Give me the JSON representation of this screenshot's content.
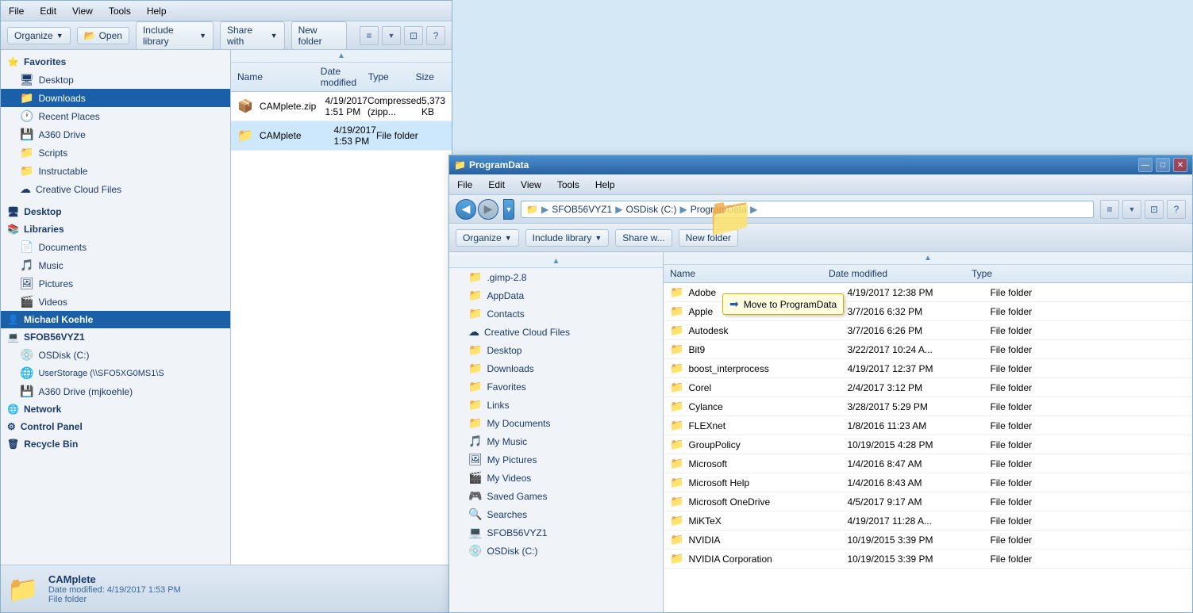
{
  "mainWindow": {
    "menuBar": {
      "items": [
        "File",
        "Edit",
        "View",
        "Tools",
        "Help"
      ]
    },
    "toolbar": {
      "organize": "Organize",
      "open": "Open",
      "includeLibrary": "Include library",
      "shareWith": "Share with",
      "newFolder": "New folder"
    },
    "sidebar": {
      "sections": [
        {
          "header": "Favorites",
          "icon": "⭐",
          "items": [
            {
              "label": "Desktop",
              "icon": "🖥"
            },
            {
              "label": "Downloads",
              "icon": "📁",
              "selected": true
            },
            {
              "label": "Recent Places",
              "icon": "🕐"
            },
            {
              "label": "A360 Drive",
              "icon": "💾"
            },
            {
              "label": "Scripts",
              "icon": "📁"
            },
            {
              "label": "Instructable",
              "icon": "📁"
            },
            {
              "label": "Creative Cloud Files",
              "icon": "☁"
            }
          ]
        },
        {
          "header": "Desktop",
          "icon": "🖥",
          "items": []
        },
        {
          "header": "Libraries",
          "icon": "📚",
          "items": [
            {
              "label": "Documents",
              "icon": "📄"
            },
            {
              "label": "Music",
              "icon": "🎵"
            },
            {
              "label": "Pictures",
              "icon": "🖼"
            },
            {
              "label": "Videos",
              "icon": "🎬"
            }
          ]
        },
        {
          "header": "Michael Koehle",
          "icon": "👤",
          "items": []
        },
        {
          "header": "SFOB56VYZ1",
          "icon": "💻",
          "items": [
            {
              "label": "OSDisk (C:)",
              "icon": "💿"
            },
            {
              "label": "UserStorage (\\\\SFO5XG0MS1\\S",
              "icon": "🌐"
            },
            {
              "label": "A360 Drive (mjkoehle)",
              "icon": "💾"
            }
          ]
        },
        {
          "header": "Network",
          "icon": "🌐",
          "items": []
        },
        {
          "header": "Control Panel",
          "icon": "⚙",
          "items": []
        },
        {
          "header": "Recycle Bin",
          "icon": "🗑",
          "items": []
        }
      ]
    },
    "fileList": {
      "headers": [
        "Name",
        "Date modified",
        "Type",
        "Size"
      ],
      "rows": [
        {
          "name": "CAMplete.zip",
          "icon": "📦",
          "date": "4/19/2017 1:51 PM",
          "type": "Compressed (zipp...",
          "size": "5,373 KB"
        },
        {
          "name": "CAMplete",
          "icon": "📁",
          "date": "4/19/2017 1:53 PM",
          "type": "File folder",
          "size": ""
        }
      ]
    },
    "statusBar": {
      "icon": "📁",
      "name": "CAMplete",
      "dateLabel": "Date modified:",
      "date": "4/19/2017 1:53 PM",
      "type": "File folder"
    }
  },
  "secondWindow": {
    "breadcrumb": {
      "parts": [
        "SFOB56VYZ1",
        "OSDisk (C:)",
        "ProgramData"
      ]
    },
    "toolbar": {
      "organize": "Organize",
      "includeLibrary": "Include library",
      "shareWith": "Share w...",
      "newFolder": "New folder"
    },
    "sidebar": {
      "items": [
        {
          "label": ".gimp-2.8",
          "icon": "📁"
        },
        {
          "label": "AppData",
          "icon": "📁"
        },
        {
          "label": "Contacts",
          "icon": "📁"
        },
        {
          "label": "Creative Cloud Files",
          "icon": "☁"
        },
        {
          "label": "Desktop",
          "icon": "📁"
        },
        {
          "label": "Downloads",
          "icon": "📁"
        },
        {
          "label": "Favorites",
          "icon": "📁"
        },
        {
          "label": "Links",
          "icon": "📁"
        },
        {
          "label": "My Documents",
          "icon": "📁"
        },
        {
          "label": "My Music",
          "icon": "🎵"
        },
        {
          "label": "My Pictures",
          "icon": "🖼"
        },
        {
          "label": "My Videos",
          "icon": "🎬"
        },
        {
          "label": "Saved Games",
          "icon": "🎮"
        },
        {
          "label": "Searches",
          "icon": "🔍"
        },
        {
          "label": "SFOB56VYZ1",
          "icon": "💻"
        },
        {
          "label": "OSDisk (C:)",
          "icon": "💿"
        }
      ]
    },
    "fileList": {
      "headers": [
        "Name",
        "Date modified",
        "Type"
      ],
      "rows": [
        {
          "name": "Adobe",
          "icon": "📁",
          "date": "4/19/2017 12:38 PM",
          "type": "File folder"
        },
        {
          "name": "Apple",
          "icon": "📁",
          "date": "3/7/2016 6:32 PM",
          "type": "File folder"
        },
        {
          "name": "Autodesk",
          "icon": "📁",
          "date": "3/7/2016 6:26 PM",
          "type": "File folder"
        },
        {
          "name": "Bit9",
          "icon": "📁",
          "date": "3/22/2017 10:24 A...",
          "type": "File folder"
        },
        {
          "name": "boost_interprocess",
          "icon": "📁",
          "date": "4/19/2017 12:37 PM",
          "type": "File folder"
        },
        {
          "name": "Corel",
          "icon": "📁",
          "date": "2/4/2017 3:12 PM",
          "type": "File folder"
        },
        {
          "name": "Cylance",
          "icon": "📁",
          "date": "3/28/2017 5:29 PM",
          "type": "File folder"
        },
        {
          "name": "FLEXnet",
          "icon": "📁",
          "date": "1/8/2016 11:23 AM",
          "type": "File folder"
        },
        {
          "name": "GroupPolicy",
          "icon": "📁",
          "date": "10/19/2015 4:28 PM",
          "type": "File folder"
        },
        {
          "name": "Microsoft",
          "icon": "📁",
          "date": "1/4/2016 8:47 AM",
          "type": "File folder"
        },
        {
          "name": "Microsoft Help",
          "icon": "📁",
          "date": "1/4/2016 8:43 AM",
          "type": "File folder"
        },
        {
          "name": "Microsoft OneDrive",
          "icon": "📁",
          "date": "4/5/2017 9:17 AM",
          "type": "File folder"
        },
        {
          "name": "MiKTeX",
          "icon": "📁",
          "date": "4/19/2017 11:28 A...",
          "type": "File folder"
        },
        {
          "name": "NVIDIA",
          "icon": "📁",
          "date": "10/19/2015 3:39 PM",
          "type": "File folder"
        },
        {
          "name": "NVIDIA Corporation",
          "icon": "📁",
          "date": "10/19/2015 3:39 PM",
          "type": "File folder"
        }
      ]
    },
    "dragTooltip": "Move to ProgramData"
  }
}
